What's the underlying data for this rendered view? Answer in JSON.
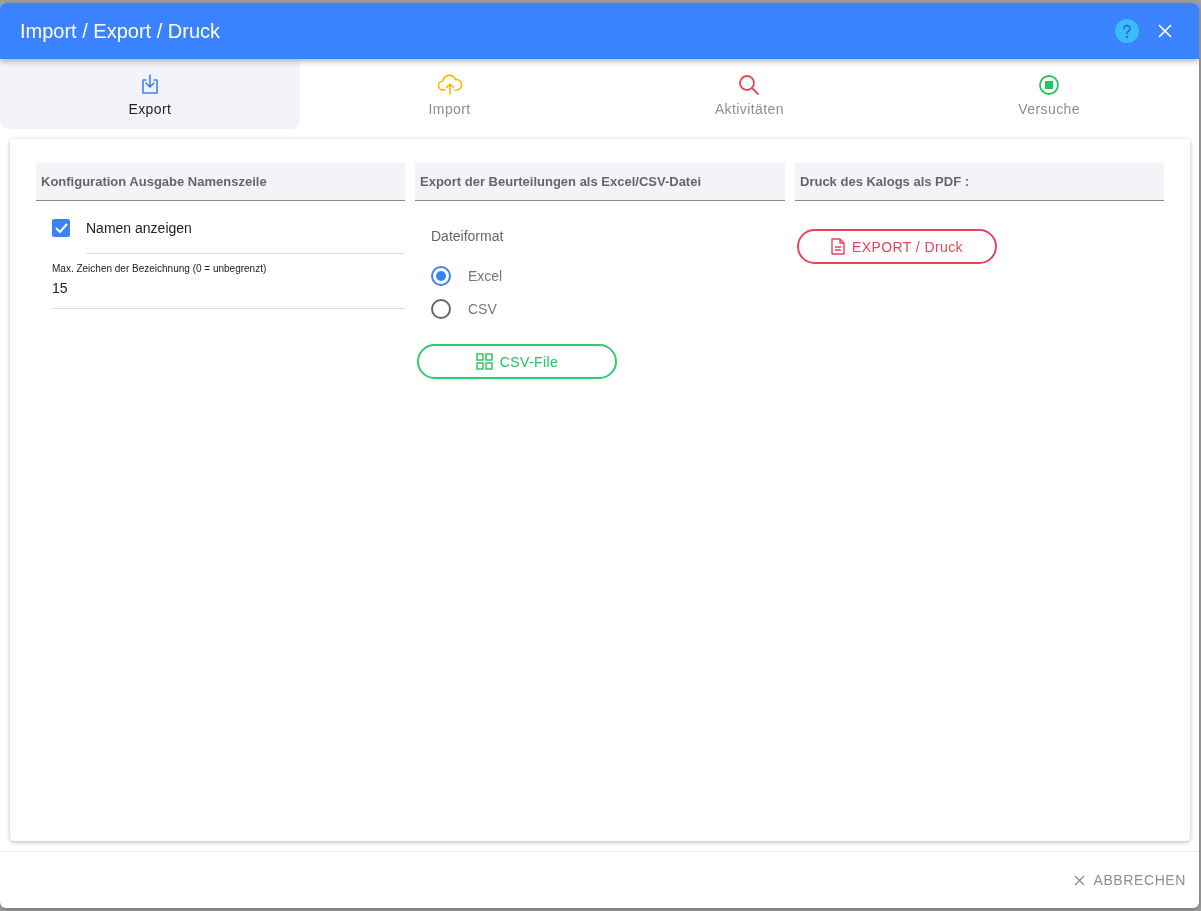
{
  "window": {
    "title": "Import / Export / Druck"
  },
  "tabs": [
    {
      "kind": "export",
      "label": "Export",
      "selected": true
    },
    {
      "kind": "import",
      "label": "Import",
      "selected": false
    },
    {
      "kind": "activities",
      "label": "Aktivitäten",
      "selected": false
    },
    {
      "kind": "attempts",
      "label": "Versuche",
      "selected": false
    }
  ],
  "sections": [
    {
      "kind": "name_config",
      "heading": "Konfiguration Ausgabe Namenszeile",
      "checkbox": {
        "label": "Namen anzeigen",
        "checked": true
      },
      "field": {
        "label": "Max. Zeichen der Bezeichnung (0 = unbegrenzt)",
        "value": "15"
      }
    },
    {
      "kind": "file_export",
      "heading": "Export der Beurteilungen als Excel/CSV-Datei",
      "format_label": "Dateiformat",
      "options": [
        {
          "label": "Excel",
          "selected": true
        },
        {
          "label": "CSV",
          "selected": false
        }
      ],
      "button": "CSV-File"
    },
    {
      "kind": "pdf_print",
      "heading": "Druck des Kalogs als PDF :",
      "button": "EXPORT / Druck"
    }
  ],
  "footer": {
    "cancel": "ABBRECHEN"
  }
}
